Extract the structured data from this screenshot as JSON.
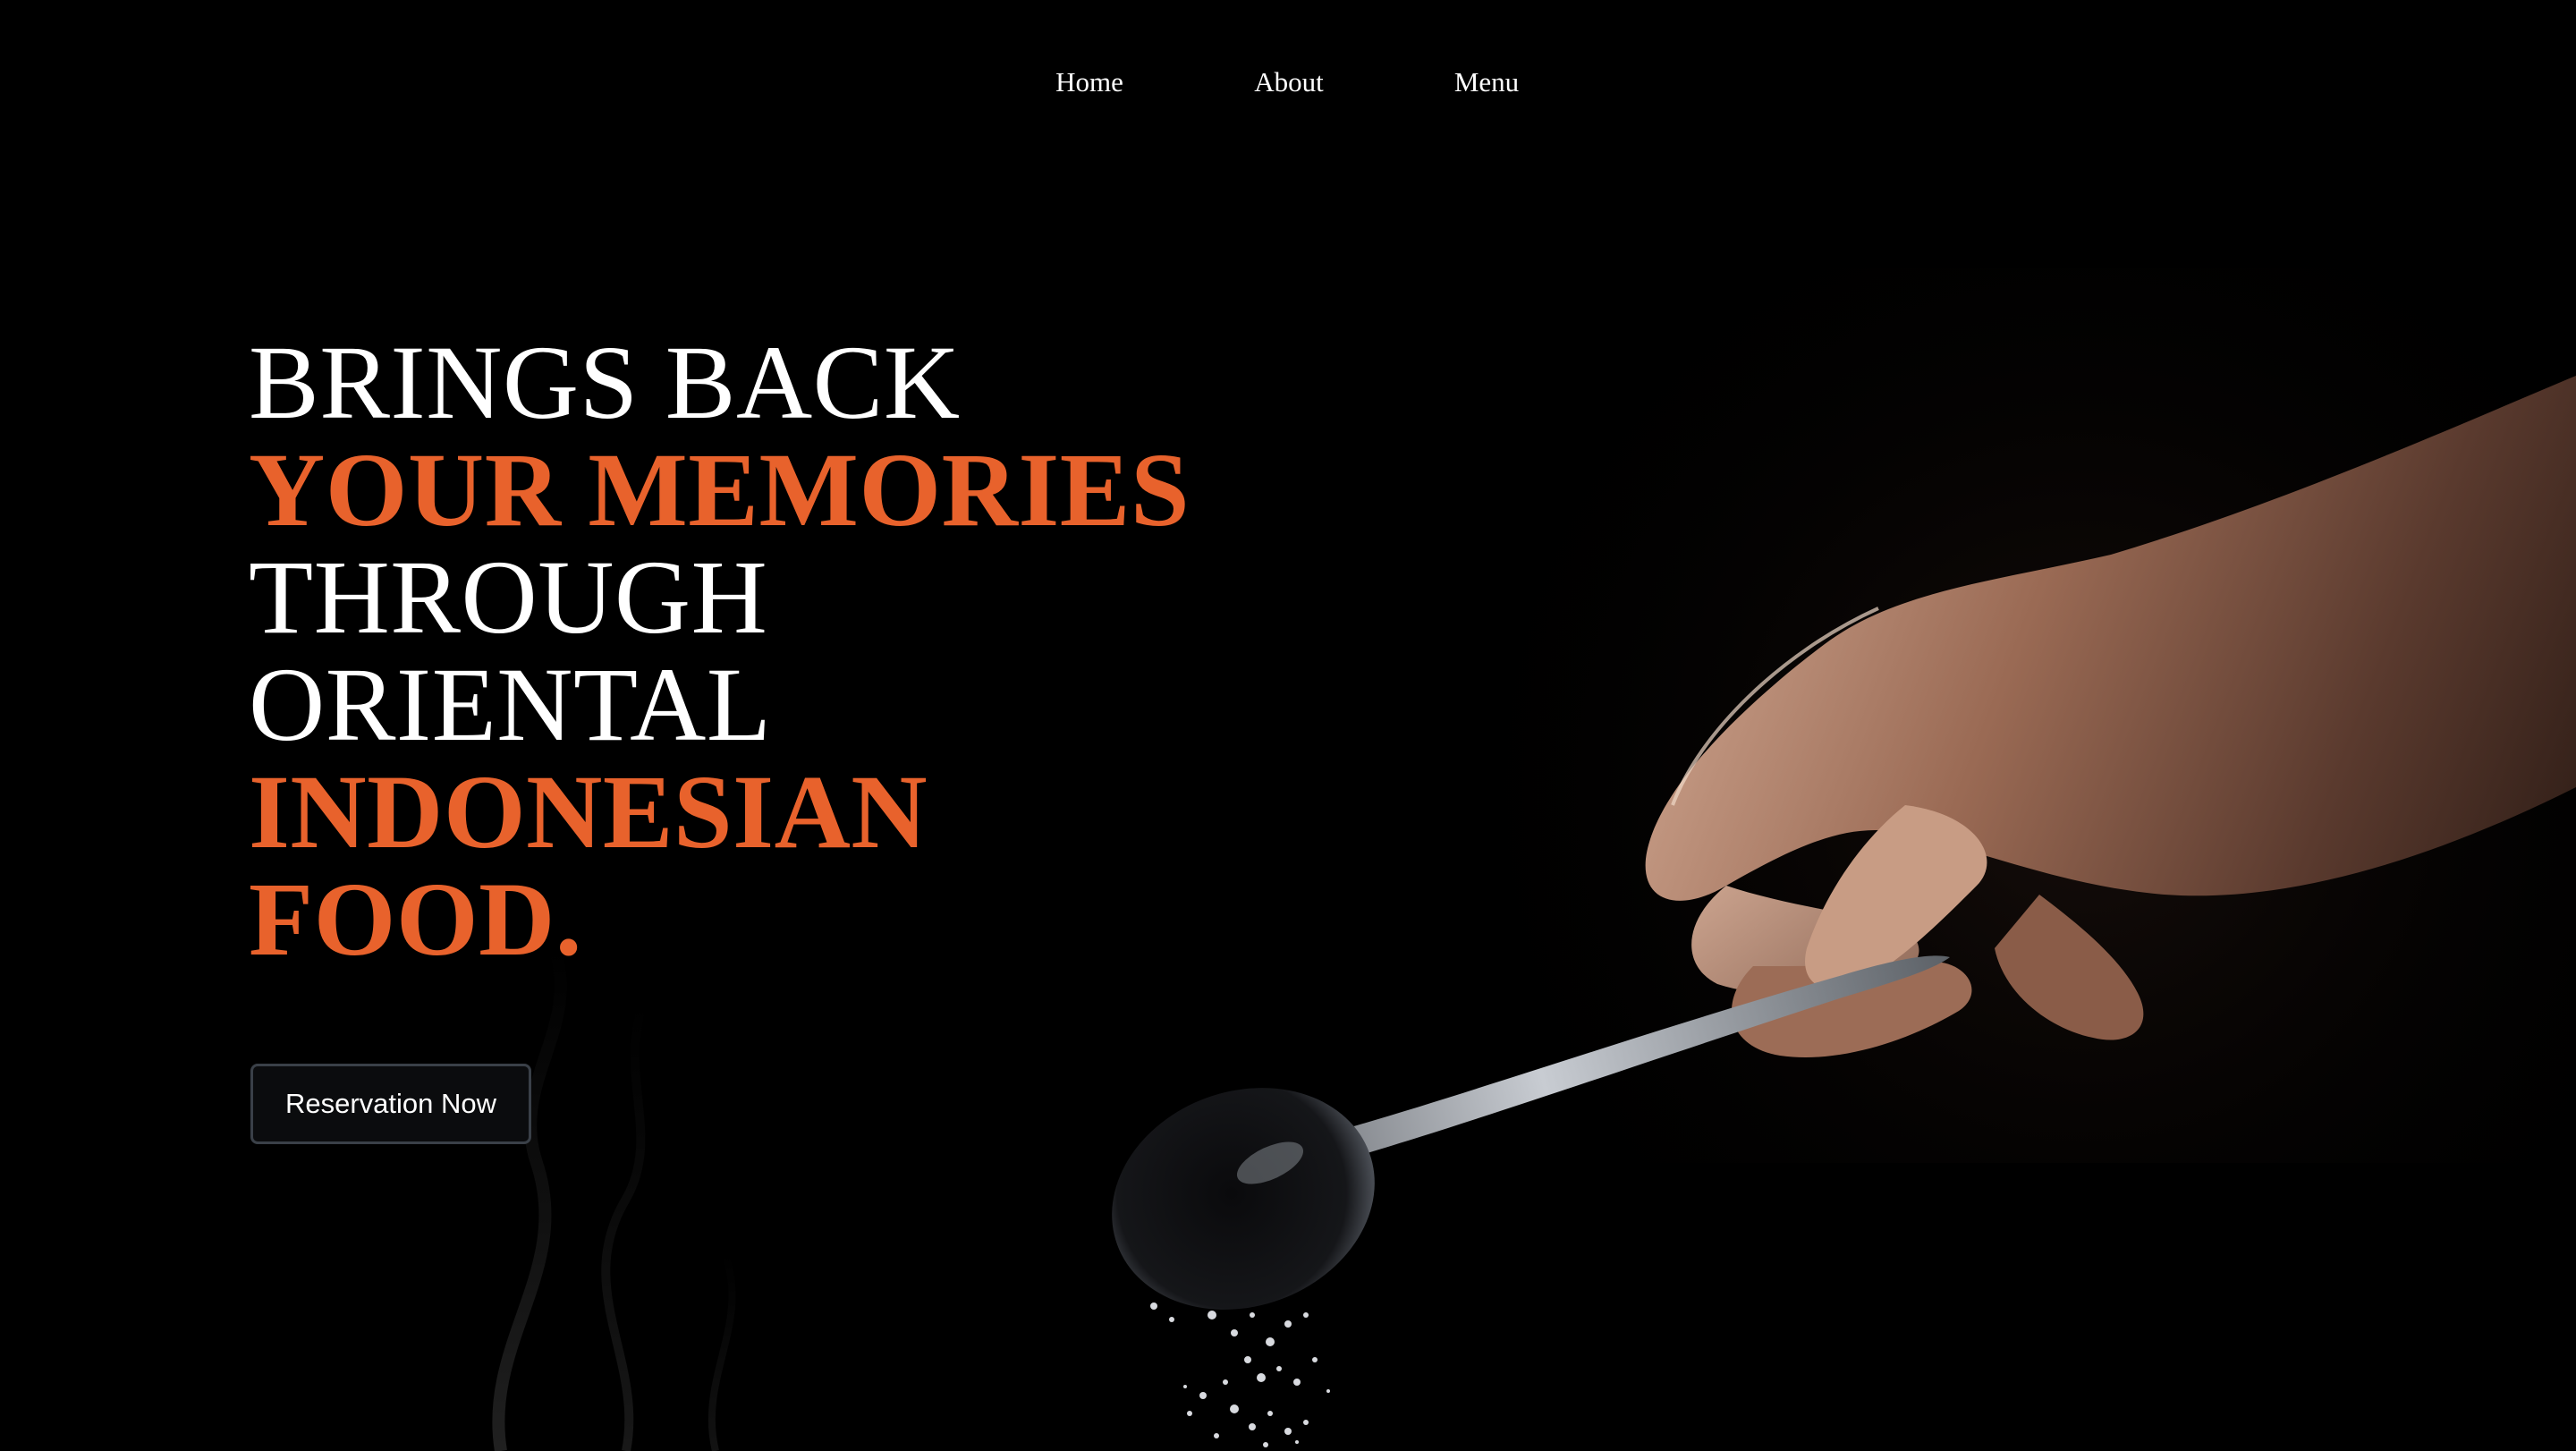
{
  "nav": {
    "items": [
      {
        "label": "Home"
      },
      {
        "label": "About"
      },
      {
        "label": "Menu"
      }
    ]
  },
  "hero": {
    "lines": [
      {
        "text": "BRINGS BACK",
        "style": "white"
      },
      {
        "text": "YOUR MEMORIES",
        "style": "orange"
      },
      {
        "text": "THROUGH",
        "style": "white"
      },
      {
        "text": "ORIENTAL",
        "style": "white"
      },
      {
        "text": "INDONESIAN",
        "style": "orange"
      },
      {
        "text": "FOOD.",
        "style": "orange"
      }
    ],
    "cta_label": "Reservation Now"
  },
  "colors": {
    "background": "#000000",
    "accent": "#e8622c",
    "text": "#ffffff",
    "button_border": "#3a4048"
  },
  "image": {
    "description_icon": "hand-spoon-salt-photo"
  }
}
